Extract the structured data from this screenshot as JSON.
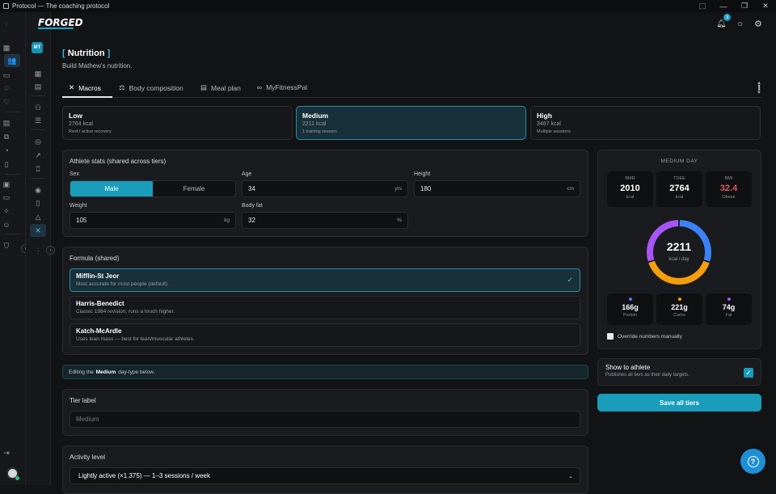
{
  "window": {
    "title": "Protocol — The coaching protocol",
    "controls": [
      "⬚",
      "—",
      "❐",
      "✕"
    ]
  },
  "brand": {
    "logo": "FORGED",
    "accent": "#18a6c6"
  },
  "header": {
    "notification_count": "3",
    "icons": [
      "bell-icon",
      "sun-icon",
      "gear-icon"
    ]
  },
  "athlete": {
    "initials": "MT"
  },
  "page": {
    "title": "Nutrition",
    "title_open": "[",
    "title_close": "]",
    "subtitle": "Build Mathew's nutrition."
  },
  "tabs": [
    {
      "label": "Macros",
      "icon": "utensils-icon",
      "active": true
    },
    {
      "label": "Body composition",
      "icon": "scale-icon"
    },
    {
      "label": "Meal plan",
      "icon": "calendar-icon"
    },
    {
      "label": "MyFitnessPal",
      "icon": "link-icon"
    }
  ],
  "tiers": [
    {
      "name": "Low",
      "kcal": "2764 kcal",
      "desc": "Rest / active recovery"
    },
    {
      "name": "Medium",
      "kcal": "2211 kcal",
      "desc": "1 training session",
      "active": true
    },
    {
      "name": "High",
      "kcal": "3487 kcal",
      "desc": "Multiple sessions"
    }
  ],
  "stats": {
    "title": "Athlete stats (shared across tiers)",
    "sex_label": "Sex",
    "sex_options": [
      "Male",
      "Female"
    ],
    "sex_selected": "Male",
    "age_label": "Age",
    "age": "34",
    "age_unit": "yrs",
    "height_label": "Height",
    "height": "180",
    "height_unit": "cm",
    "weight_label": "Weight",
    "weight": "105",
    "weight_unit": "kg",
    "bodyfat_label": "Body fat",
    "bodyfat": "32",
    "bodyfat_unit": "%"
  },
  "formula": {
    "title": "Formula (shared)",
    "options": [
      {
        "name": "Mifflin-St Jeor",
        "desc": "Most accurate for most people (default).",
        "selected": true
      },
      {
        "name": "Harris-Benedict",
        "desc": "Classic 1984 revision; runs a touch higher."
      },
      {
        "name": "Katch-McArdle",
        "desc": "Uses lean mass — best for lean/muscular athletes."
      }
    ]
  },
  "editing": {
    "prefix": "Editing the",
    "tier": "Medium",
    "suffix": "day-type below."
  },
  "tier_label": {
    "title": "Tier label",
    "placeholder": "Medium"
  },
  "activity": {
    "title": "Activity level",
    "value": "Lightly active (×1.375) — 1–3 sessions / week"
  },
  "summary": {
    "title": "MEDIUM DAY",
    "bmr_label": "BMR",
    "bmr": "2010",
    "bmr_unit": "kcal",
    "tdee_label": "TDEE",
    "tdee": "2764",
    "tdee_unit": "kcal",
    "bmi_label": "BMI",
    "bmi": "32.4",
    "bmi_status": "Obese",
    "bmi_color": "#e05a5a",
    "kcal": "2211",
    "kcal_unit": "kcal / day",
    "macros": [
      {
        "name": "Protein",
        "value": "166g",
        "color": "#3b82f6",
        "fraction": 0.3
      },
      {
        "name": "Carbs",
        "value": "221g",
        "color": "#f59e0b",
        "fraction": 0.4
      },
      {
        "name": "Fat",
        "value": "74g",
        "color": "#a855f7",
        "fraction": 0.3
      }
    ],
    "override_label": "Override numbers manually"
  },
  "show_athlete": {
    "title": "Show to athlete",
    "desc": "Publishes all tiers as their daily targets.",
    "checked": true
  },
  "save_button": "Save all tiers",
  "help_icon": "?"
}
